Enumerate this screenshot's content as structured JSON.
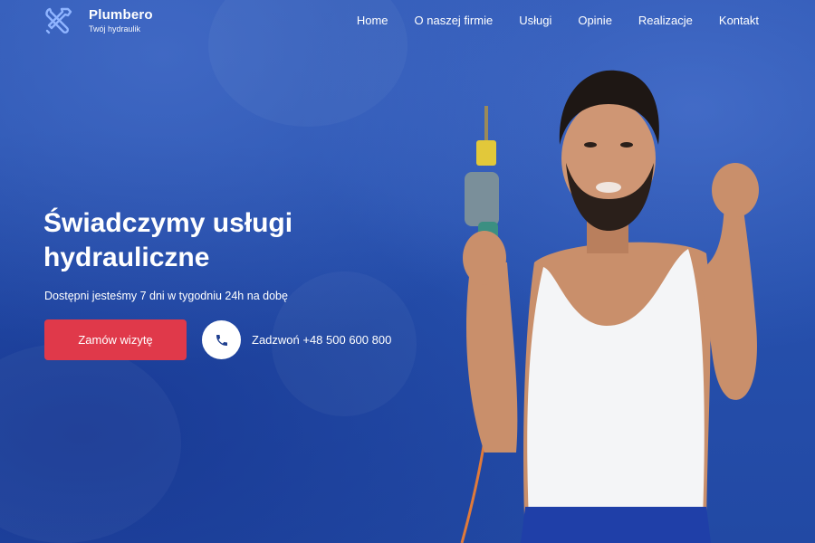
{
  "brand": {
    "name": "Plumbero",
    "tagline": "Twój hydraulik",
    "icon": "wrench-screwdriver-icon"
  },
  "nav": {
    "items": [
      {
        "label": "Home"
      },
      {
        "label": "O naszej firmie"
      },
      {
        "label": "Usługi"
      },
      {
        "label": "Opinie"
      },
      {
        "label": "Realizacje"
      },
      {
        "label": "Kontakt"
      }
    ]
  },
  "hero": {
    "headline": "Świadczymy usługi hydrauliczne",
    "subline": "Dostępni jesteśmy 7 dni w tygodniu 24h na dobę",
    "cta_label": "Zamów wizytę",
    "call_label": "Zadzwoń +48 500 600 800",
    "call_icon": "phone-icon",
    "image": "plumber-with-drill-photo"
  },
  "colors": {
    "background": "#2a4fa8",
    "cta": "#e0394a",
    "text": "#ffffff"
  }
}
